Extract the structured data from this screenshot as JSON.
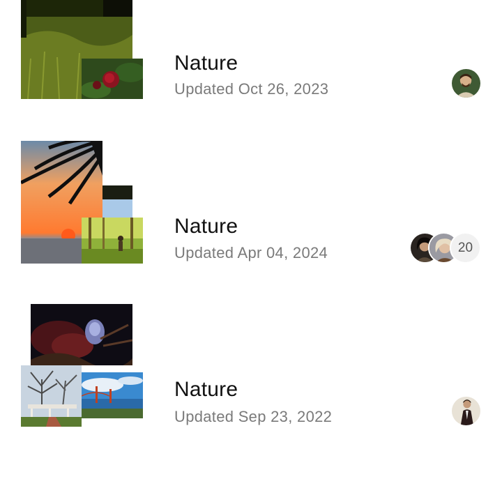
{
  "albums": [
    {
      "title": "Nature",
      "subtitle": "Updated Oct 26, 2023",
      "avatar": "man-beard-avatar"
    },
    {
      "title": "Nature",
      "subtitle": "Updated Apr 04, 2024",
      "avatars": [
        "dark-hair-avatar",
        "blonde-avatar"
      ],
      "extra_count": "20"
    },
    {
      "title": "Nature",
      "subtitle": "Updated Sep 23, 2022",
      "avatar": "man-standing-avatar"
    }
  ]
}
